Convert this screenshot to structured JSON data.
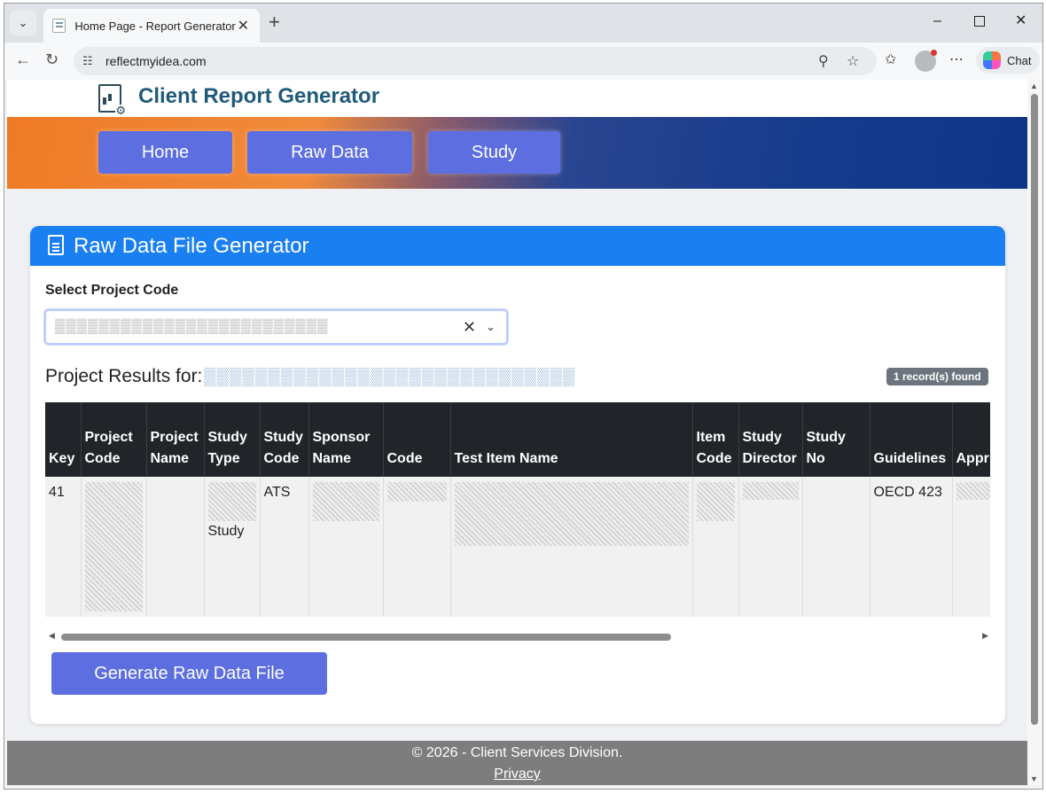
{
  "browser": {
    "tab_title": "Home Page - Report Generator",
    "url": "reflectmyidea.com",
    "chat_label": "Chat",
    "icons": {
      "tab_list": "chevron-down-icon",
      "new_tab": "plus-icon",
      "back": "arrow-left-icon",
      "refresh": "refresh-icon",
      "zoom": "zoom-icon",
      "favorite": "star-icon",
      "favorites": "favorites-icon",
      "more": "more-icon"
    }
  },
  "app": {
    "brand_title": "Client Report Generator",
    "nav": [
      {
        "label": "Home"
      },
      {
        "label": "Raw Data"
      },
      {
        "label": "Study"
      }
    ]
  },
  "card": {
    "title": "Raw Data File Generator",
    "select_label": "Select Project Code",
    "select_value": "▒▒▒▒▒▒▒▒▒▒▒▒▒▒▒▒▒▒▒▒▒▒▒▒▒",
    "results_label": "Project Results for:",
    "results_code": "▒▒▒▒▒▒▒▒▒▒▒▒▒▒▒▒▒▒▒▒▒▒▒▒▒▒▒▒▒",
    "records_badge": "1 record(s) found",
    "table": {
      "columns": [
        "Key",
        "Project Code",
        "Project Name",
        "Study Type",
        "Study Code",
        "Sponsor Name",
        "Code",
        "Test Item Name",
        "Item Code",
        "Study Director",
        "Study No",
        "Guidelines",
        "Appr By"
      ],
      "row": {
        "key": "41",
        "study_type_suffix": "Study",
        "study_code": "ATS",
        "guidelines": "OECD 423"
      }
    },
    "generate_button": "Generate Raw Data File"
  },
  "footer": {
    "copyright": "© 2026 - Client Services Division.",
    "privacy": "Privacy"
  },
  "colors": {
    "accent_blue": "#1a7ff0",
    "button_purple": "#5c6ee0",
    "nav_orange": "#ef7a26",
    "nav_navy": "#0e3688",
    "brand_text": "#1f5b7a",
    "table_header": "#212529",
    "footer_gray": "#7d7d7d"
  }
}
